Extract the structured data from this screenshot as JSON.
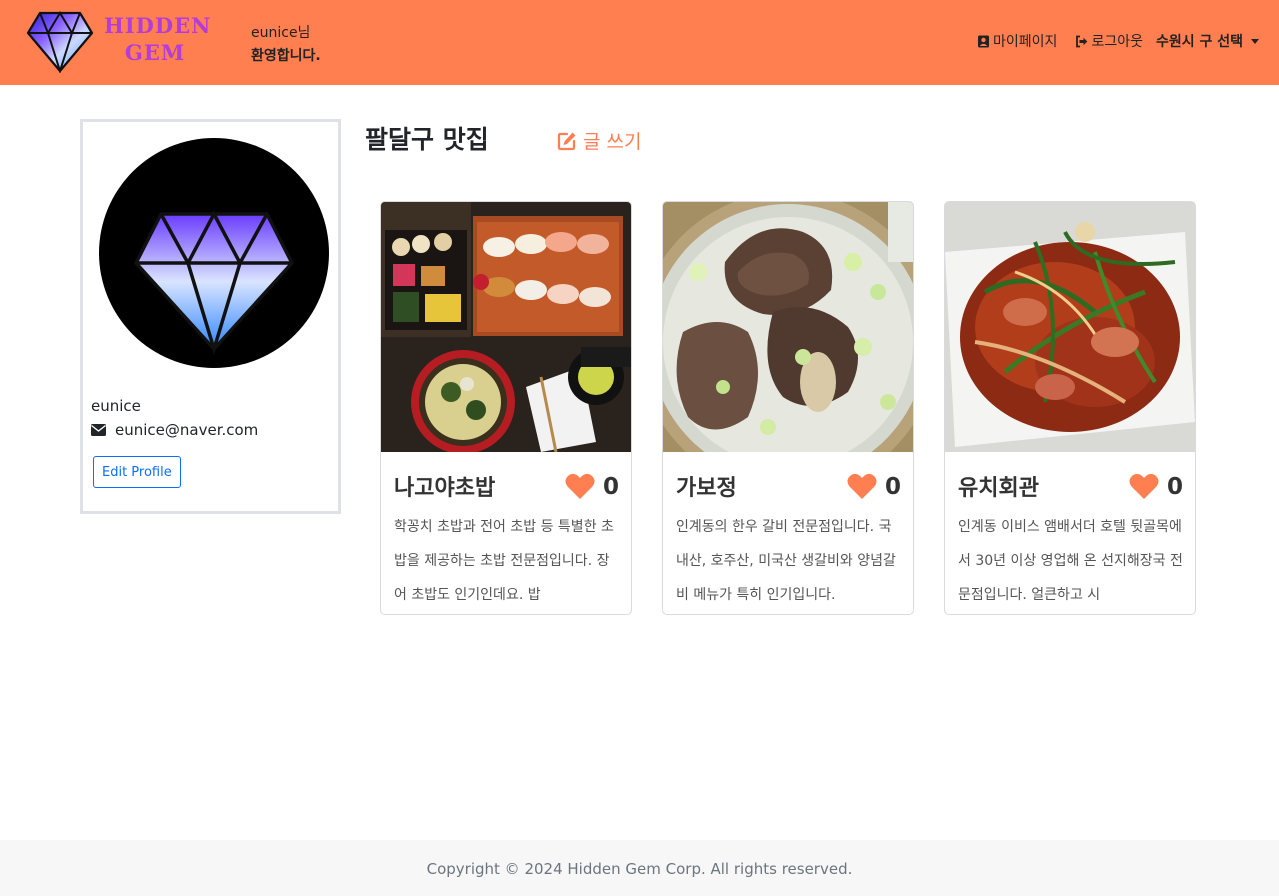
{
  "header": {
    "logo_line1": "HIDDEN",
    "logo_line2": "GEM",
    "greeting_line1": "eunice님",
    "greeting_line2": "환영합니다.",
    "mypage_label": "마이페이지",
    "logout_label": "로그아웃",
    "region_label": "수원시 구 선택",
    "brand_color": "#ff7f50"
  },
  "profile": {
    "name": "eunice",
    "email": "eunice@naver.com",
    "edit_label": "Edit Profile"
  },
  "main": {
    "title": "팔달구 맛집",
    "write_label": "글 쓰기"
  },
  "cards": [
    {
      "title": "나고야초밥",
      "likes": "0",
      "description": "학꽁치 초밥과 전어 초밥 등 특별한 초밥을 제공하는 초밥 전문점입니다. 장어 초밥도 인기인데요. 밥"
    },
    {
      "title": "가보정",
      "likes": "0",
      "description": "인계동의 한우 갈비 전문점입니다. 국내산, 호주산, 미국산 생갈비와 양념갈비 메뉴가 특히 인기입니다."
    },
    {
      "title": "유치회관",
      "likes": "0",
      "description": "인계동 이비스 앰배서더 호텔 뒷골목에서 30년 이상 영업해 온 선지해장국 전문점입니다. 얼큰하고 시"
    }
  ],
  "footer": {
    "copyright": "Copyright © 2024 Hidden Gem Corp. All rights reserved."
  },
  "icons": {
    "logo": "diamond-icon",
    "mypage": "user-badge-icon",
    "logout": "sign-out-icon",
    "email": "envelope-icon",
    "write": "edit-icon",
    "like": "heart-icon"
  }
}
